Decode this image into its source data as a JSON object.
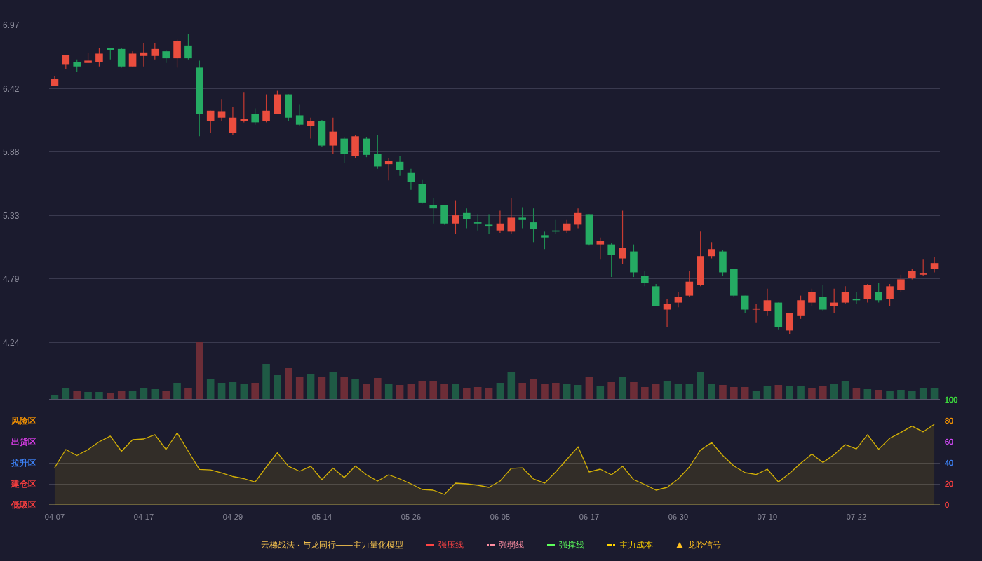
{
  "price_chart": {
    "chart_data": {
      "type": "candlestick",
      "ylim": [
        4.24,
        6.97
      ],
      "yticks": [
        6.97,
        6.42,
        5.88,
        5.33,
        4.79,
        4.24
      ],
      "grid": true,
      "ohlc": [
        [
          6.44,
          6.53,
          6.44,
          6.5
        ],
        [
          6.63,
          6.71,
          6.59,
          6.71
        ],
        [
          6.65,
          6.67,
          6.56,
          6.61
        ],
        [
          6.64,
          6.73,
          6.64,
          6.66
        ],
        [
          6.65,
          6.77,
          6.61,
          6.72
        ],
        [
          6.77,
          6.77,
          6.67,
          6.75
        ],
        [
          6.76,
          6.77,
          6.6,
          6.61
        ],
        [
          6.61,
          6.74,
          6.61,
          6.72
        ],
        [
          6.7,
          6.81,
          6.61,
          6.73
        ],
        [
          6.7,
          6.81,
          6.67,
          6.76
        ],
        [
          6.74,
          6.75,
          6.64,
          6.68
        ],
        [
          6.68,
          6.84,
          6.6,
          6.83
        ],
        [
          6.79,
          6.89,
          6.67,
          6.68
        ],
        [
          6.6,
          6.66,
          6.01,
          6.2
        ],
        [
          6.14,
          6.23,
          6.04,
          6.23
        ],
        [
          6.17,
          6.33,
          6.14,
          6.22
        ],
        [
          6.04,
          6.26,
          6.02,
          6.17
        ],
        [
          6.14,
          6.39,
          6.13,
          6.16
        ],
        [
          6.2,
          6.25,
          6.11,
          6.13
        ],
        [
          6.14,
          6.37,
          6.13,
          6.23
        ],
        [
          6.2,
          6.4,
          6.2,
          6.37
        ],
        [
          6.37,
          6.37,
          6.14,
          6.17
        ],
        [
          6.19,
          6.28,
          6.1,
          6.11
        ],
        [
          6.1,
          6.17,
          5.99,
          6.14
        ],
        [
          6.14,
          6.15,
          5.92,
          5.93
        ],
        [
          5.93,
          6.17,
          5.86,
          6.05
        ],
        [
          5.99,
          6.0,
          5.78,
          5.86
        ],
        [
          5.84,
          6.02,
          5.82,
          6.01
        ],
        [
          5.99,
          6.0,
          5.83,
          5.85
        ],
        [
          5.86,
          6.02,
          5.73,
          5.75
        ],
        [
          5.77,
          5.82,
          5.63,
          5.8
        ],
        [
          5.79,
          5.84,
          5.67,
          5.72
        ],
        [
          5.7,
          5.73,
          5.55,
          5.62
        ],
        [
          5.6,
          5.64,
          5.43,
          5.44
        ],
        [
          5.42,
          5.48,
          5.26,
          5.39
        ],
        [
          5.42,
          5.42,
          5.25,
          5.26
        ],
        [
          5.26,
          5.46,
          5.17,
          5.33
        ],
        [
          5.35,
          5.39,
          5.22,
          5.3
        ],
        [
          5.27,
          5.34,
          5.2,
          5.26
        ],
        [
          5.25,
          5.34,
          5.17,
          5.24
        ],
        [
          5.2,
          5.37,
          5.18,
          5.26
        ],
        [
          5.19,
          5.48,
          5.17,
          5.31
        ],
        [
          5.31,
          5.4,
          5.22,
          5.29
        ],
        [
          5.27,
          5.39,
          5.1,
          5.21
        ],
        [
          5.16,
          5.19,
          5.04,
          5.14
        ],
        [
          5.2,
          5.29,
          5.17,
          5.19
        ],
        [
          5.2,
          5.29,
          5.18,
          5.26
        ],
        [
          5.25,
          5.39,
          5.22,
          5.35
        ],
        [
          5.34,
          5.34,
          5.07,
          5.08
        ],
        [
          5.08,
          5.14,
          4.95,
          5.11
        ],
        [
          5.08,
          5.09,
          4.8,
          4.99
        ],
        [
          4.96,
          5.37,
          4.91,
          5.05
        ],
        [
          5.02,
          5.08,
          4.8,
          4.84
        ],
        [
          4.81,
          4.85,
          4.72,
          4.75
        ],
        [
          4.72,
          4.74,
          4.55,
          4.55
        ],
        [
          4.52,
          4.61,
          4.37,
          4.57
        ],
        [
          4.58,
          4.67,
          4.54,
          4.63
        ],
        [
          4.64,
          4.85,
          4.63,
          4.76
        ],
        [
          4.73,
          5.19,
          4.72,
          4.98
        ],
        [
          4.98,
          5.1,
          4.96,
          5.04
        ],
        [
          5.02,
          5.03,
          4.81,
          4.84
        ],
        [
          4.87,
          4.87,
          4.63,
          4.64
        ],
        [
          4.64,
          4.64,
          4.49,
          4.52
        ],
        [
          4.52,
          4.57,
          4.41,
          4.53
        ],
        [
          4.51,
          4.7,
          4.47,
          4.6
        ],
        [
          4.58,
          4.58,
          4.35,
          4.37
        ],
        [
          4.34,
          4.49,
          4.31,
          4.49
        ],
        [
          4.47,
          4.64,
          4.44,
          4.6
        ],
        [
          4.58,
          4.7,
          4.55,
          4.67
        ],
        [
          4.63,
          4.73,
          4.51,
          4.52
        ],
        [
          4.55,
          4.7,
          4.49,
          4.58
        ],
        [
          4.58,
          4.72,
          4.57,
          4.67
        ],
        [
          4.61,
          4.67,
          4.57,
          4.6
        ],
        [
          4.61,
          4.74,
          4.58,
          4.73
        ],
        [
          4.67,
          4.75,
          4.58,
          4.6
        ],
        [
          4.61,
          4.74,
          4.55,
          4.72
        ],
        [
          4.69,
          4.82,
          4.67,
          4.78
        ],
        [
          4.79,
          4.87,
          4.78,
          4.85
        ],
        [
          4.82,
          4.95,
          4.81,
          4.83
        ],
        [
          4.87,
          4.97,
          4.84,
          4.92
        ]
      ]
    }
  },
  "indicator": {
    "zones": [
      {
        "label": "风险区",
        "color": "#ff9900"
      },
      {
        "label": "出货区",
        "color": "#e23ff0"
      },
      {
        "label": "拉升区",
        "color": "#3f87ff"
      },
      {
        "label": "建仓区",
        "color": "#ff4040"
      },
      {
        "label": "低吸区",
        "color": "#ff4040"
      }
    ],
    "ytick_styles": [
      {
        "color": "#ff4040"
      },
      {
        "color": "#ff4040"
      },
      {
        "color": "#3f87ff"
      },
      {
        "color": "#d94cff"
      },
      {
        "color": "#ff9900"
      },
      {
        "color": "#3ee03e"
      }
    ],
    "chart_data": {
      "type": "area",
      "grid": true,
      "ylim": [
        0,
        100
      ],
      "yticks": [
        0,
        20,
        40,
        60,
        80,
        100
      ],
      "categories": [
        "04-07",
        null,
        null,
        null,
        null,
        null,
        null,
        null,
        "04-17",
        null,
        null,
        null,
        null,
        null,
        null,
        null,
        "04-29",
        null,
        null,
        null,
        null,
        null,
        null,
        null,
        "05-14",
        null,
        null,
        null,
        null,
        null,
        null,
        null,
        "05-26",
        null,
        null,
        null,
        null,
        null,
        null,
        null,
        "06-05",
        null,
        null,
        null,
        null,
        null,
        null,
        null,
        "06-17",
        null,
        null,
        null,
        null,
        null,
        null,
        null,
        "06-30",
        null,
        null,
        null,
        null,
        null,
        null,
        null,
        "07-10",
        null,
        null,
        null,
        null,
        null,
        null,
        null,
        "07-22",
        null,
        null,
        null,
        null,
        null,
        null,
        null
      ],
      "values": [
        35.5,
        52.7,
        47,
        52.7,
        60,
        65.5,
        51,
        62,
        62.7,
        66.7,
        52.7,
        68.4,
        51,
        33.8,
        33.3,
        30.4,
        27,
        25,
        21.8,
        36,
        49.6,
        36.7,
        32,
        36.7,
        24,
        35,
        26,
        37,
        28.7,
        22.7,
        28.7,
        24.7,
        20,
        14.7,
        14,
        10,
        20.7,
        20,
        18.7,
        16.7,
        22.7,
        34.7,
        35.3,
        24.7,
        20.7,
        31.3,
        43.3,
        55.3,
        31.3,
        34,
        28.7,
        36.7,
        24,
        19.3,
        14,
        16.7,
        24.7,
        36,
        52.2,
        59.3,
        47,
        37,
        30.7,
        28.9,
        34,
        21.8,
        30,
        39.6,
        48.4,
        40.4,
        47.8,
        57.3,
        53.3,
        66.7,
        52.9,
        63.3,
        68.9,
        74.9,
        69.5,
        76.7
      ]
    }
  },
  "legend": {
    "title": "云梯战法 · 与龙同行——主力量化模型",
    "items": [
      {
        "kind": "solid",
        "label": "强压线",
        "color": "#ff4444"
      },
      {
        "kind": "dashed",
        "label": "强弱线",
        "color": "#ff8fa3"
      },
      {
        "kind": "solid",
        "label": "强撑线",
        "color": "#5cff5c"
      },
      {
        "kind": "dashed",
        "label": "主力成本",
        "color": "#ffd400"
      },
      {
        "kind": "triangle",
        "label": "龙吟信号",
        "color": "#ffc020"
      }
    ]
  }
}
